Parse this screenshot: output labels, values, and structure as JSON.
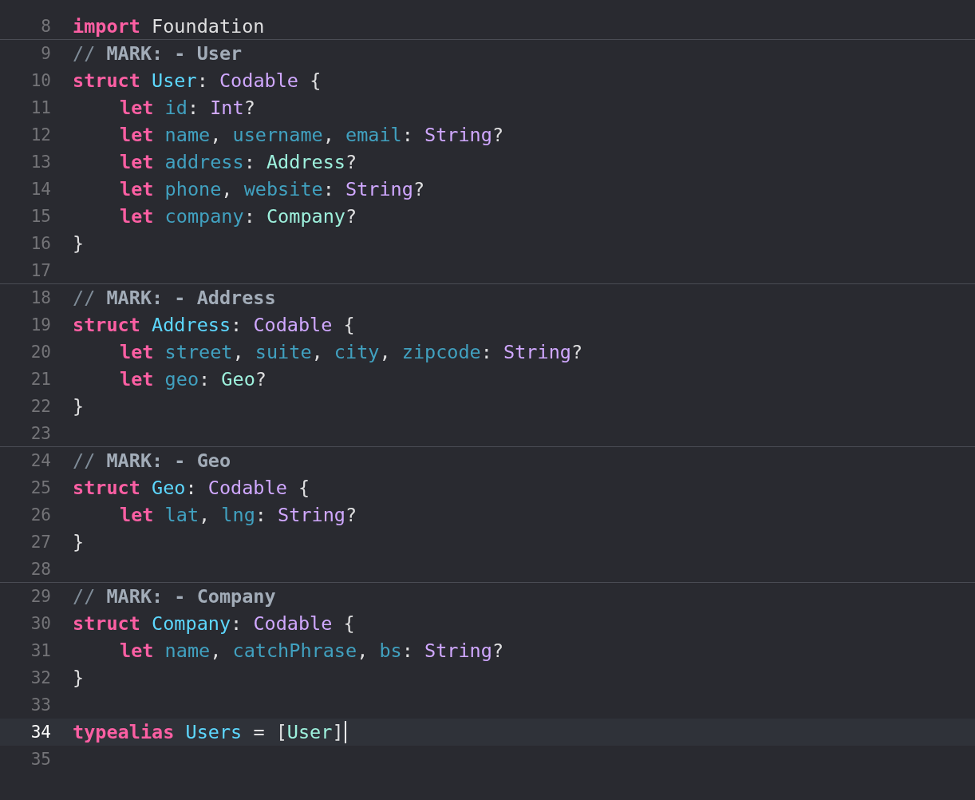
{
  "editor": {
    "lines": [
      {
        "number": "8",
        "current": false,
        "mark": false,
        "tokens": [
          {
            "kind": "keyword",
            "text": "import"
          },
          {
            "kind": "plain",
            "text": " Foundation"
          }
        ]
      },
      {
        "number": "9",
        "current": false,
        "mark": true,
        "tokens": [
          {
            "kind": "comment",
            "text": "//"
          },
          {
            "kind": "mark",
            "text": " MARK: - User"
          }
        ]
      },
      {
        "number": "10",
        "current": false,
        "mark": false,
        "tokens": [
          {
            "kind": "keyword",
            "text": "struct"
          },
          {
            "kind": "declaration",
            "text": " User"
          },
          {
            "kind": "plain",
            "text": ": "
          },
          {
            "kind": "system-type",
            "text": "Codable"
          },
          {
            "kind": "plain",
            "text": " {"
          }
        ],
        "children": [
          {
            "number": "11",
            "current": false,
            "mark": false,
            "tokens": [
              {
                "kind": "keyword",
                "text": "let"
              },
              {
                "kind": "property",
                "text": " id"
              },
              {
                "kind": "plain",
                "text": ": "
              },
              {
                "kind": "system-type",
                "text": "Int"
              },
              {
                "kind": "plain",
                "text": "?"
              }
            ]
          },
          {
            "number": "12",
            "current": false,
            "mark": false,
            "tokens": [
              {
                "kind": "keyword",
                "text": "let"
              },
              {
                "kind": "property",
                "text": " name"
              },
              {
                "kind": "plain",
                "text": ", "
              },
              {
                "kind": "property",
                "text": "username"
              },
              {
                "kind": "plain",
                "text": ", "
              },
              {
                "kind": "property",
                "text": "email"
              },
              {
                "kind": "plain",
                "text": ": "
              },
              {
                "kind": "system-type",
                "text": "String"
              },
              {
                "kind": "plain",
                "text": "?"
              }
            ]
          },
          {
            "number": "13",
            "current": false,
            "mark": false,
            "tokens": [
              {
                "kind": "keyword",
                "text": "let"
              },
              {
                "kind": "property",
                "text": " address"
              },
              {
                "kind": "plain",
                "text": ": "
              },
              {
                "kind": "project-type",
                "text": "Address"
              },
              {
                "kind": "plain",
                "text": "?"
              }
            ]
          },
          {
            "number": "14",
            "current": false,
            "mark": false,
            "tokens": [
              {
                "kind": "keyword",
                "text": "let"
              },
              {
                "kind": "property",
                "text": " phone"
              },
              {
                "kind": "plain",
                "text": ", "
              },
              {
                "kind": "property",
                "text": "website"
              },
              {
                "kind": "plain",
                "text": ": "
              },
              {
                "kind": "system-type",
                "text": "String"
              },
              {
                "kind": "plain",
                "text": "?"
              }
            ]
          },
          {
            "number": "15",
            "current": false,
            "mark": false,
            "tokens": [
              {
                "kind": "keyword",
                "text": "let"
              },
              {
                "kind": "property",
                "text": " company"
              },
              {
                "kind": "plain",
                "text": ": "
              },
              {
                "kind": "project-type",
                "text": "Company"
              },
              {
                "kind": "plain",
                "text": "?"
              }
            ]
          }
        ]
      },
      {
        "number": "16",
        "current": false,
        "mark": false,
        "tokens": [
          {
            "kind": "plain",
            "text": "}"
          }
        ]
      },
      {
        "number": "17",
        "current": false,
        "mark": false
      },
      {
        "number": "18",
        "current": false,
        "mark": true,
        "tokens": [
          {
            "kind": "comment",
            "text": "//"
          },
          {
            "kind": "mark",
            "text": " MARK: - Address"
          }
        ]
      },
      {
        "number": "19",
        "current": false,
        "mark": false,
        "tokens": [
          {
            "kind": "keyword",
            "text": "struct"
          },
          {
            "kind": "declaration",
            "text": " Address"
          },
          {
            "kind": "plain",
            "text": ": "
          },
          {
            "kind": "system-type",
            "text": "Codable"
          },
          {
            "kind": "plain",
            "text": " {"
          }
        ],
        "children": [
          {
            "number": "20",
            "current": false,
            "mark": false,
            "tokens": [
              {
                "kind": "keyword",
                "text": "let"
              },
              {
                "kind": "property",
                "text": " street"
              },
              {
                "kind": "plain",
                "text": ", "
              },
              {
                "kind": "property",
                "text": "suite"
              },
              {
                "kind": "plain",
                "text": ", "
              },
              {
                "kind": "property",
                "text": "city"
              },
              {
                "kind": "plain",
                "text": ", "
              },
              {
                "kind": "property",
                "text": "zipcode"
              },
              {
                "kind": "plain",
                "text": ": "
              },
              {
                "kind": "system-type",
                "text": "String"
              },
              {
                "kind": "plain",
                "text": "?"
              }
            ]
          },
          {
            "number": "21",
            "current": false,
            "mark": false,
            "tokens": [
              {
                "kind": "keyword",
                "text": "let"
              },
              {
                "kind": "property",
                "text": " geo"
              },
              {
                "kind": "plain",
                "text": ": "
              },
              {
                "kind": "project-type",
                "text": "Geo"
              },
              {
                "kind": "plain",
                "text": "?"
              }
            ]
          }
        ]
      },
      {
        "number": "22",
        "current": false,
        "mark": false,
        "tokens": [
          {
            "kind": "plain",
            "text": "}"
          }
        ]
      },
      {
        "number": "23",
        "current": false,
        "mark": false
      },
      {
        "number": "24",
        "current": false,
        "mark": true,
        "tokens": [
          {
            "kind": "comment",
            "text": "//"
          },
          {
            "kind": "mark",
            "text": " MARK: - Geo"
          }
        ]
      },
      {
        "number": "25",
        "current": false,
        "mark": false,
        "tokens": [
          {
            "kind": "keyword",
            "text": "struct"
          },
          {
            "kind": "declaration",
            "text": " Geo"
          },
          {
            "kind": "plain",
            "text": ": "
          },
          {
            "kind": "system-type",
            "text": "Codable"
          },
          {
            "kind": "plain",
            "text": " {"
          }
        ],
        "children": [
          {
            "number": "26",
            "current": false,
            "mark": false,
            "tokens": [
              {
                "kind": "keyword",
                "text": "let"
              },
              {
                "kind": "property",
                "text": " lat"
              },
              {
                "kind": "plain",
                "text": ", "
              },
              {
                "kind": "property",
                "text": "lng"
              },
              {
                "kind": "plain",
                "text": ": "
              },
              {
                "kind": "system-type",
                "text": "String"
              },
              {
                "kind": "plain",
                "text": "?"
              }
            ]
          }
        ]
      },
      {
        "number": "27",
        "current": false,
        "mark": false,
        "tokens": [
          {
            "kind": "plain",
            "text": "}"
          }
        ]
      },
      {
        "number": "28",
        "current": false,
        "mark": false
      },
      {
        "number": "29",
        "current": false,
        "mark": true,
        "tokens": [
          {
            "kind": "comment",
            "text": "//"
          },
          {
            "kind": "mark",
            "text": " MARK: - Company"
          }
        ]
      },
      {
        "number": "30",
        "current": false,
        "mark": false,
        "tokens": [
          {
            "kind": "keyword",
            "text": "struct"
          },
          {
            "kind": "declaration",
            "text": " Company"
          },
          {
            "kind": "plain",
            "text": ": "
          },
          {
            "kind": "system-type",
            "text": "Codable"
          },
          {
            "kind": "plain",
            "text": " {"
          }
        ],
        "children": [
          {
            "number": "31",
            "current": false,
            "mark": false,
            "tokens": [
              {
                "kind": "keyword",
                "text": "let"
              },
              {
                "kind": "property",
                "text": " name"
              },
              {
                "kind": "plain",
                "text": ", "
              },
              {
                "kind": "property",
                "text": "catchPhrase"
              },
              {
                "kind": "plain",
                "text": ", "
              },
              {
                "kind": "property",
                "text": "bs"
              },
              {
                "kind": "plain",
                "text": ": "
              },
              {
                "kind": "system-type",
                "text": "String"
              },
              {
                "kind": "plain",
                "text": "?"
              }
            ]
          }
        ]
      },
      {
        "number": "32",
        "current": false,
        "mark": false,
        "tokens": [
          {
            "kind": "plain",
            "text": "}"
          }
        ]
      },
      {
        "number": "33",
        "current": false,
        "mark": false
      },
      {
        "number": "34",
        "current": true,
        "mark": false,
        "tokens": [
          {
            "kind": "keyword",
            "text": "typealias"
          },
          {
            "kind": "declaration",
            "text": " Users"
          },
          {
            "kind": "plain",
            "text": " = ["
          },
          {
            "kind": "project-type",
            "text": "User"
          },
          {
            "kind": "plain",
            "text": "]"
          }
        ]
      },
      {
        "number": "35",
        "current": false,
        "mark": false
      }
    ]
  }
}
